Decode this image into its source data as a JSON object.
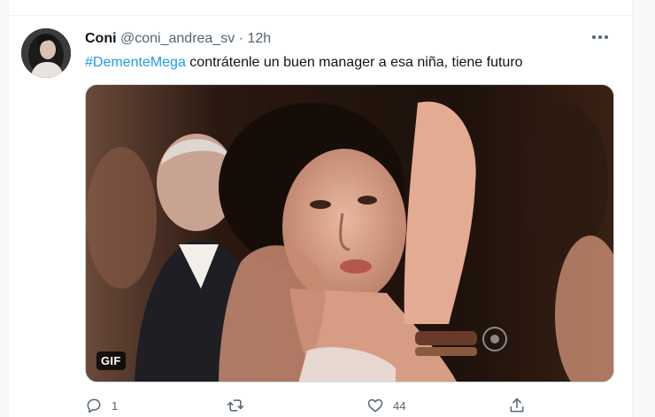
{
  "tweet": {
    "author_name": "Coni",
    "author_handle": "@coni_andrea_sv",
    "separator": "·",
    "time": "12h",
    "more_label": "···",
    "hashtag": "#DementeMega",
    "text": " contrátenle un buen manager a esa niña, tiene futuro",
    "media_badge": "GIF"
  },
  "actions": {
    "reply_count": "1",
    "retweet_count": "",
    "like_count": "44"
  },
  "icons": {
    "avatar": "avatar-photo",
    "more": "more-dots-icon",
    "reply": "reply-icon",
    "retweet": "retweet-icon",
    "like": "heart-icon",
    "share": "share-icon"
  },
  "colors": {
    "link": "#1d9bf0",
    "secondary_text": "#536471",
    "border": "#cfd9de"
  }
}
